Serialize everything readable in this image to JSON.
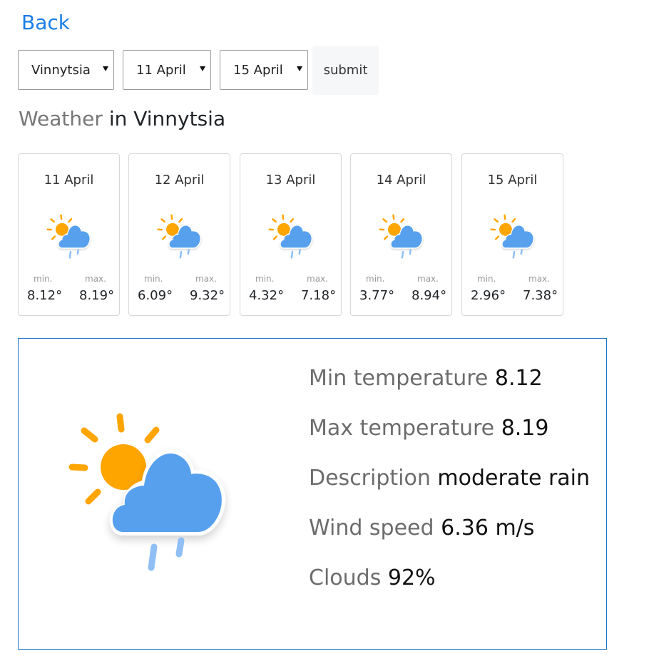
{
  "nav": {
    "back_label": "Back"
  },
  "form": {
    "city": "Vinnytsia",
    "from_date": "11 April",
    "to_date": "15 April",
    "submit_label": "submit"
  },
  "heading": {
    "prefix": "Weather",
    "suffix": "in Vinnytsia"
  },
  "forecast": [
    {
      "date": "11 April",
      "min_label": "min.",
      "max_label": "max.",
      "min": "8.12°",
      "max": "8.19°",
      "icon": "sun-cloud-rain-icon"
    },
    {
      "date": "12 April",
      "min_label": "min.",
      "max_label": "max.",
      "min": "6.09°",
      "max": "9.32°",
      "icon": "sun-cloud-rain-icon"
    },
    {
      "date": "13 April",
      "min_label": "min.",
      "max_label": "max.",
      "min": "4.32°",
      "max": "7.18°",
      "icon": "sun-cloud-rain-icon"
    },
    {
      "date": "14 April",
      "min_label": "min.",
      "max_label": "max.",
      "min": "3.77°",
      "max": "8.94°",
      "icon": "sun-cloud-rain-icon"
    },
    {
      "date": "15 April",
      "min_label": "min.",
      "max_label": "max.",
      "min": "2.96°",
      "max": "7.38°",
      "icon": "sun-cloud-rain-icon"
    }
  ],
  "details": {
    "icon": "sun-cloud-rain-icon",
    "min_temp": {
      "label": "Min temperature",
      "value": "8.12"
    },
    "max_temp": {
      "label": "Max temperature",
      "value": "8.19"
    },
    "description": {
      "label": "Description",
      "value": "moderate rain"
    },
    "wind": {
      "label": "Wind speed",
      "value": "6.36 m/s"
    },
    "clouds": {
      "label": "Clouds",
      "value": "92%"
    }
  },
  "colors": {
    "link": "#1a7ee6",
    "panel_border": "#1a73c9",
    "sun": "#ffa500",
    "cloud": "#56a0ee",
    "rain": "#8fbff5"
  }
}
